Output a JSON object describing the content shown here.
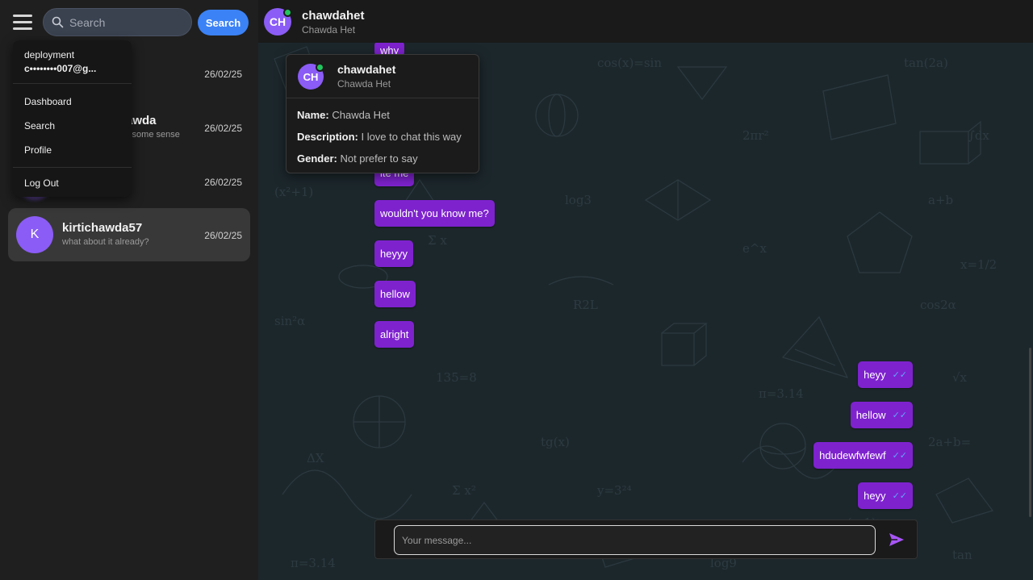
{
  "sidebar": {
    "search": {
      "placeholder": "Search",
      "button_label": "Search"
    },
    "chats": [
      {
        "name": "",
        "preview": "",
        "date": "26/02/25",
        "avatar": ""
      },
      {
        "name": "awda",
        "preview": "s some sense",
        "date": "26/02/25",
        "avatar": ""
      },
      {
        "name": "",
        "preview": "",
        "date": "26/02/25",
        "avatar": ""
      },
      {
        "name": "kirtichawda57",
        "preview": "what about it already?",
        "date": "26/02/25",
        "avatar": "K"
      }
    ]
  },
  "menu": {
    "user_name": "deployment",
    "user_email": "c••••••••007@g...",
    "items": [
      "Dashboard",
      "Search",
      "Profile",
      "Log Out"
    ]
  },
  "header": {
    "initials": "CH",
    "name": "chawdahet",
    "subtitle": "Chawda Het"
  },
  "popover": {
    "initials": "CH",
    "name": "chawdahet",
    "subtitle": "Chawda Het",
    "name_label": "Name:",
    "name_value": "Chawda Het",
    "description_label": "Description:",
    "description_value": "I love to chat this way",
    "gender_label": "Gender:",
    "gender_value": "Not prefer to say"
  },
  "messages": {
    "received": [
      "why",
      "ite me",
      "wouldn't you know me?",
      "heyyy",
      "hellow",
      "alright"
    ],
    "sent": [
      "heyy",
      "hellow",
      "hdudewfwfewf",
      "heyy"
    ]
  },
  "composer": {
    "placeholder": "Your message..."
  },
  "colors": {
    "accent": "#7e22ce",
    "button": "#3b82f6",
    "online": "#22c55e",
    "read_ticks": "#60a5fa"
  }
}
